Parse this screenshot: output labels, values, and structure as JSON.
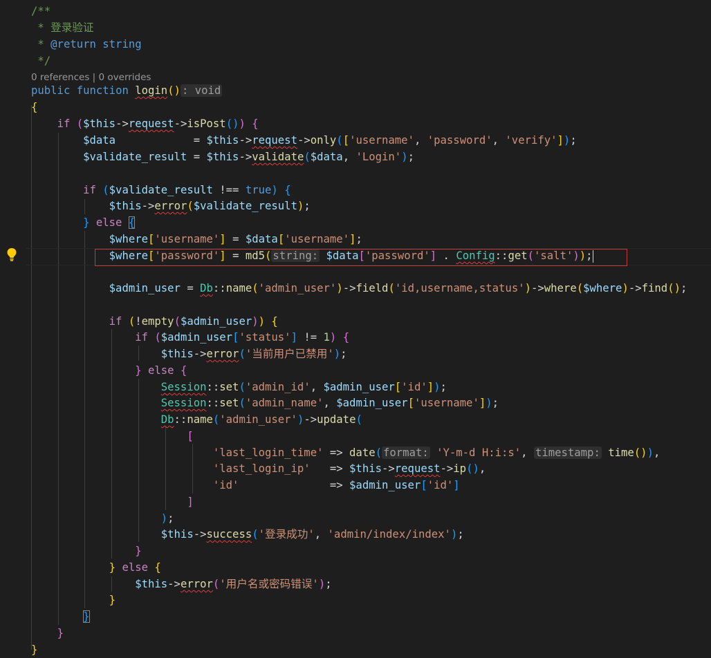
{
  "editor": {
    "language": "php",
    "theme_colors": {
      "background": "#1e1e1e",
      "keyword": "#569cd6",
      "control": "#c586c0",
      "variable": "#9cdcfe",
      "string": "#ce9178",
      "function": "#dcdcaa",
      "class": "#4ec9b0",
      "comment": "#6a9955",
      "highlight_box": "#c33a3a"
    },
    "codelens": "0 references | 0 overrides",
    "lines": [
      "/**",
      " * 登录验证",
      " * @return string",
      " */",
      "public function login(): void",
      "{",
      "    if ($this->request->isPost()) {",
      "        $data            = $this->request->only(['username', 'password', 'verify']);",
      "        $validate_result = $this->validate($data, 'Login');",
      "",
      "        if ($validate_result !== true) {",
      "            $this->error($validate_result);",
      "        } else {",
      "            $where['username'] = $data['username'];",
      "            $where['password'] = md5(string: $data['password'] . Config::get('salt'));",
      "",
      "            $admin_user = Db::name('admin_user')->field('id,username,status')->where($where)->find();",
      "",
      "            if (!empty($admin_user)) {",
      "                if ($admin_user['status'] != 1) {",
      "                    $this->error('当前用户已禁用');",
      "                } else {",
      "                    Session::set('admin_id', $admin_user['id']);",
      "                    Session::set('admin_name', $admin_user['username']);",
      "                    Db::name('admin_user')->update(",
      "                        [",
      "                            'last_login_time' => date(format: 'Y-m-d H:i:s', timestamp: time()),",
      "                            'last_login_ip'   => $this->request->ip(),",
      "                            'id'              => $admin_user['id']",
      "                        ]",
      "                    );",
      "                    $this->success('登录成功', 'admin/index/index');",
      "                }",
      "            } else {",
      "                $this->error('用户名或密码错误');",
      "            }",
      "        }",
      "    }",
      "}"
    ],
    "icons": {
      "lightbulb": "lightbulb-icon"
    }
  }
}
